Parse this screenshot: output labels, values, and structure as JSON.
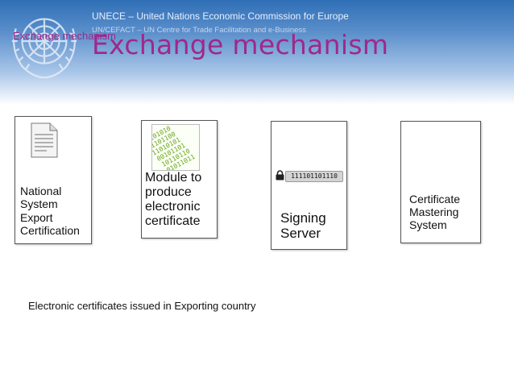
{
  "header": {
    "org_line1": "UNECE – United Nations Economic Commission for Europe",
    "org_line2": "UN/CEFACT – UN Centre for Trade Facilitation and e-Business",
    "overlay_title": "Exchange mechanism"
  },
  "slide": {
    "title": "Exchange mechanism",
    "caption": "Electronic certificates issued in Exporting country"
  },
  "boxes": [
    {
      "icon": "document-icon",
      "lines": [
        "National",
        "System",
        "Export",
        "Certification"
      ]
    },
    {
      "icon": "binary-code-icon",
      "lines": [
        "Module to",
        "produce",
        "electronic",
        "certificate"
      ]
    },
    {
      "icon": "lock-icon",
      "badge": "111101101110",
      "lines": [
        "Signing",
        "Server"
      ]
    },
    {
      "icon": "",
      "lines": [
        "Certificate",
        "Mastering",
        "System"
      ]
    }
  ],
  "binary_art": [
    "10101010",
    "01101100",
    "11010101",
    "00101101",
    "10110110",
    "01011011"
  ]
}
